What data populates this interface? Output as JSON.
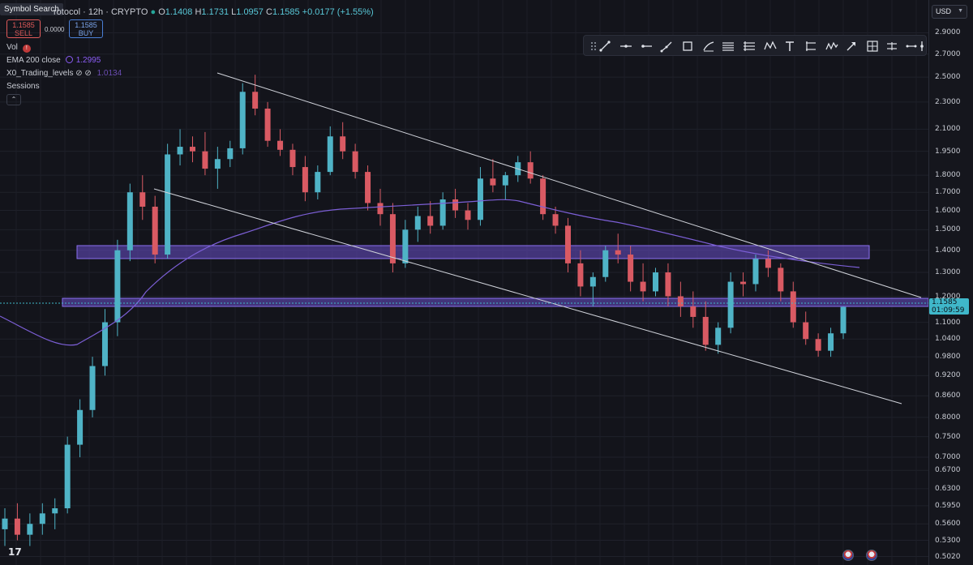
{
  "header": {
    "symbol_search_label": "Symbol Search",
    "symbol": "rotocol",
    "interval": "12h",
    "exchange": "CRYPTO",
    "open_label": "O",
    "open": "1.1408",
    "high_label": "H",
    "high": "1.1731",
    "low_label": "L",
    "low": "1.0957",
    "close_label": "C",
    "close": "1.1585",
    "change": "+0.0177 (+1.55%)"
  },
  "trade": {
    "sell_price": "1.1585",
    "sell_label": "SELL",
    "spread": "0.0000",
    "buy_price": "1.1585",
    "buy_label": "BUY"
  },
  "indicators": {
    "vol_label": "Vol",
    "vol_warning": "!",
    "ema_label": "EMA 200 close",
    "ema_value": "1.2995",
    "xo_label": "X0_Trading_levels",
    "xo_icons": "⊘ ⊘",
    "xo_value": "1.0134",
    "sessions_label": "Sessions",
    "collapse_glyph": "⌃"
  },
  "price_axis": {
    "currency": "USD",
    "ticks": [
      "2.9000",
      "2.7000",
      "2.5000",
      "2.3000",
      "2.1000",
      "1.9500",
      "1.8000",
      "1.7000",
      "1.6000",
      "1.5000",
      "1.4000",
      "1.3000",
      "1.2000",
      "1.1000",
      "1.0400",
      "0.9800",
      "0.9200",
      "0.8600",
      "0.8000",
      "0.7500",
      "0.7000",
      "0.6700",
      "0.6300",
      "0.5950",
      "0.5600",
      "0.5300",
      "0.5020"
    ],
    "last_price": "1.1585",
    "countdown": "01:09:59"
  },
  "toolbar": {
    "tools": [
      {
        "name": "drag-handle-icon"
      },
      {
        "name": "trend-line-icon"
      },
      {
        "name": "horizontal-line-icon"
      },
      {
        "name": "horizontal-ray-icon"
      },
      {
        "name": "trend-angle-icon"
      },
      {
        "name": "rectangle-icon"
      },
      {
        "name": "brush-icon"
      },
      {
        "name": "fib-retracement-icon"
      },
      {
        "name": "fib-extension-icon"
      },
      {
        "name": "xabcd-pattern-icon"
      },
      {
        "name": "text-icon"
      },
      {
        "name": "long-position-icon"
      },
      {
        "name": "elliott-wave-icon"
      },
      {
        "name": "arrow-icon"
      },
      {
        "name": "gann-box-icon"
      },
      {
        "name": "date-price-range-icon"
      },
      {
        "name": "measure-icon"
      },
      {
        "name": "pin-icon"
      }
    ]
  },
  "footer": {
    "logo_text": "17"
  },
  "chart_data": {
    "type": "candlestick",
    "y_scale": "log",
    "ylim": [
      0.5,
      3.0
    ],
    "candles": [
      [
        0.55,
        0.59,
        0.52,
        0.57
      ],
      [
        0.57,
        0.6,
        0.53,
        0.54
      ],
      [
        0.54,
        0.58,
        0.52,
        0.56
      ],
      [
        0.56,
        0.6,
        0.54,
        0.58
      ],
      [
        0.58,
        0.61,
        0.55,
        0.59
      ],
      [
        0.59,
        0.75,
        0.58,
        0.73
      ],
      [
        0.73,
        0.85,
        0.7,
        0.82
      ],
      [
        0.82,
        0.98,
        0.8,
        0.95
      ],
      [
        0.95,
        1.15,
        0.92,
        1.1
      ],
      [
        1.1,
        1.45,
        1.05,
        1.4
      ],
      [
        1.4,
        1.75,
        1.35,
        1.7
      ],
      [
        1.7,
        1.8,
        1.55,
        1.62
      ],
      [
        1.62,
        1.68,
        1.34,
        1.38
      ],
      [
        1.38,
        2.0,
        1.36,
        1.93
      ],
      [
        1.93,
        2.1,
        1.86,
        1.98
      ],
      [
        1.98,
        2.05,
        1.88,
        1.95
      ],
      [
        1.95,
        2.08,
        1.8,
        1.84
      ],
      [
        1.84,
        1.98,
        1.72,
        1.9
      ],
      [
        1.9,
        2.02,
        1.85,
        1.97
      ],
      [
        1.97,
        2.45,
        1.93,
        2.38
      ],
      [
        2.38,
        2.52,
        2.2,
        2.25
      ],
      [
        2.25,
        2.3,
        1.98,
        2.02
      ],
      [
        2.02,
        2.1,
        1.92,
        1.96
      ],
      [
        1.96,
        2.0,
        1.8,
        1.85
      ],
      [
        1.85,
        1.92,
        1.65,
        1.7
      ],
      [
        1.7,
        1.86,
        1.66,
        1.82
      ],
      [
        1.82,
        2.12,
        1.8,
        2.05
      ],
      [
        2.05,
        2.15,
        1.9,
        1.95
      ],
      [
        1.95,
        2.0,
        1.78,
        1.82
      ],
      [
        1.82,
        1.86,
        1.6,
        1.64
      ],
      [
        1.64,
        1.72,
        1.52,
        1.58
      ],
      [
        1.58,
        1.64,
        1.3,
        1.34
      ],
      [
        1.34,
        1.55,
        1.32,
        1.5
      ],
      [
        1.5,
        1.62,
        1.44,
        1.57
      ],
      [
        1.57,
        1.65,
        1.48,
        1.52
      ],
      [
        1.52,
        1.7,
        1.5,
        1.66
      ],
      [
        1.66,
        1.72,
        1.56,
        1.6
      ],
      [
        1.6,
        1.64,
        1.5,
        1.55
      ],
      [
        1.55,
        1.85,
        1.52,
        1.78
      ],
      [
        1.78,
        1.9,
        1.7,
        1.74
      ],
      [
        1.74,
        1.82,
        1.66,
        1.8
      ],
      [
        1.8,
        1.92,
        1.76,
        1.88
      ],
      [
        1.88,
        1.95,
        1.75,
        1.78
      ],
      [
        1.78,
        1.8,
        1.55,
        1.58
      ],
      [
        1.58,
        1.62,
        1.48,
        1.52
      ],
      [
        1.52,
        1.56,
        1.3,
        1.34
      ],
      [
        1.34,
        1.4,
        1.2,
        1.24
      ],
      [
        1.24,
        1.3,
        1.16,
        1.28
      ],
      [
        1.28,
        1.42,
        1.26,
        1.4
      ],
      [
        1.4,
        1.48,
        1.34,
        1.38
      ],
      [
        1.38,
        1.42,
        1.22,
        1.26
      ],
      [
        1.26,
        1.34,
        1.18,
        1.22
      ],
      [
        1.22,
        1.32,
        1.2,
        1.3
      ],
      [
        1.3,
        1.34,
        1.16,
        1.2
      ],
      [
        1.2,
        1.26,
        1.12,
        1.16
      ],
      [
        1.16,
        1.22,
        1.08,
        1.12
      ],
      [
        1.12,
        1.18,
        1.0,
        1.02
      ],
      [
        1.02,
        1.1,
        0.99,
        1.08
      ],
      [
        1.08,
        1.3,
        1.06,
        1.26
      ],
      [
        1.26,
        1.3,
        1.2,
        1.25
      ],
      [
        1.25,
        1.38,
        1.22,
        1.36
      ],
      [
        1.36,
        1.4,
        1.28,
        1.32
      ],
      [
        1.32,
        1.34,
        1.18,
        1.22
      ],
      [
        1.22,
        1.26,
        1.08,
        1.1
      ],
      [
        1.1,
        1.14,
        1.02,
        1.04
      ],
      [
        1.04,
        1.06,
        0.98,
        1.0
      ],
      [
        1.0,
        1.08,
        0.98,
        1.06
      ],
      [
        1.06,
        1.16,
        1.04,
        1.158
      ]
    ]
  }
}
